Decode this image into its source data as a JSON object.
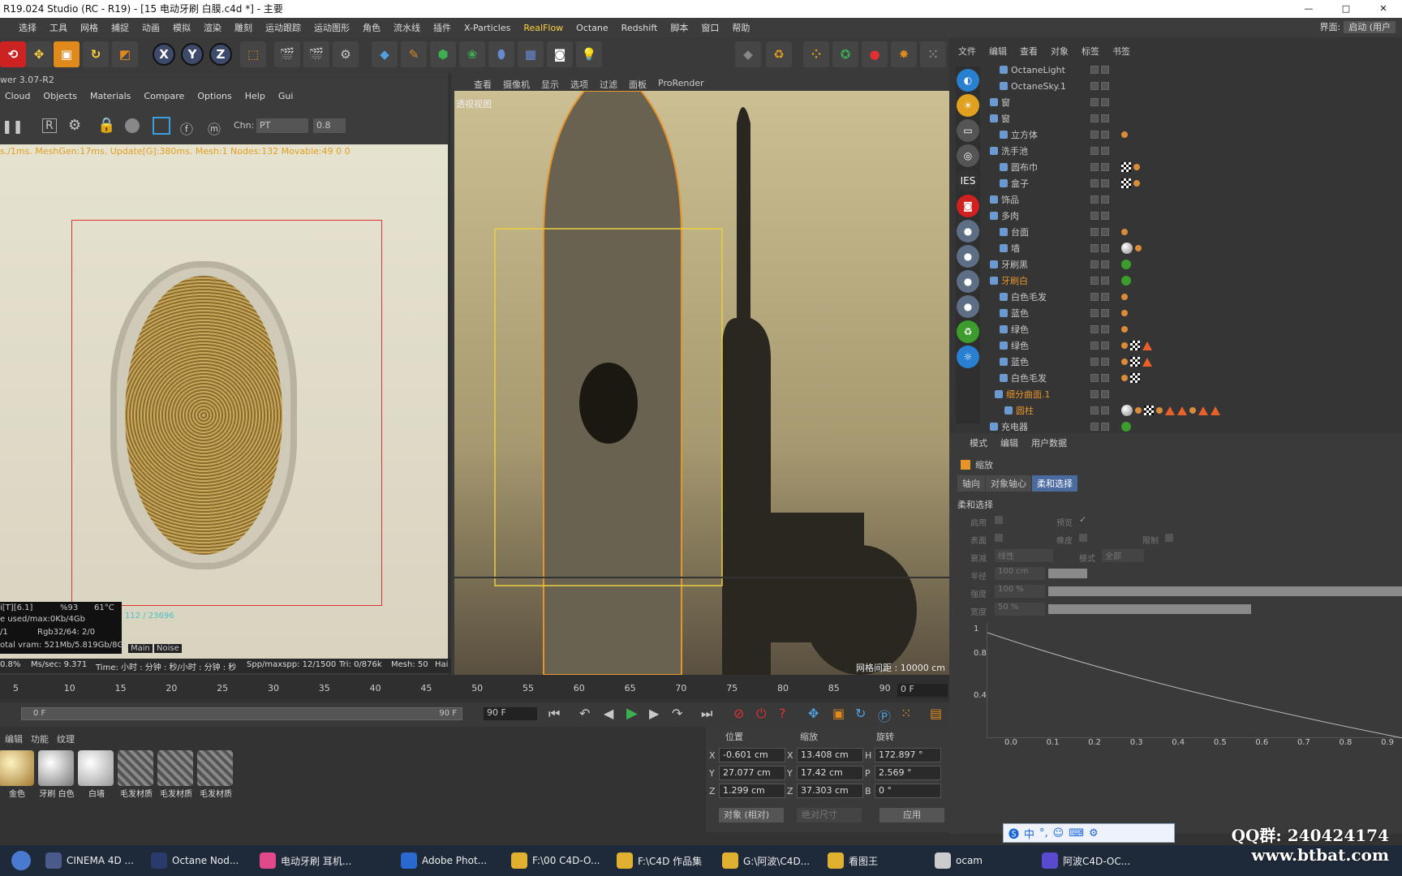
{
  "window": {
    "title": "R19.024 Studio (RC - R19) - [15 电动牙刷 白膜.c4d *] - 主要"
  },
  "menu": [
    "选择",
    "工具",
    "网格",
    "捕捉",
    "动画",
    "模拟",
    "渲染",
    "雕刻",
    "运动跟踪",
    "运动图形",
    "角色",
    "流水线",
    "插件",
    "X-Particles",
    "RealFlow",
    "Octane",
    "Redshift",
    "脚本",
    "窗口",
    "帮助"
  ],
  "layout": {
    "label": "界面:",
    "value": "启动 (用户"
  },
  "octane": {
    "version": "wer 3.07-R2",
    "menu": [
      "Cloud",
      "Objects",
      "Materials",
      "Compare",
      "Options",
      "Help",
      "Gui"
    ],
    "chn_label": "Chn:",
    "chn_value": "PT",
    "chn_num": "0.8",
    "status": "s./1ms. MeshGen:17ms. Update[G]:380ms. Mesh:1 Nodes:132 Movable:49  0 0",
    "stats": {
      "l1a": "i[T][6.1]",
      "l1b": "%93",
      "l1c": "61°C",
      "l2": "e used/max:0Kb/4Gb",
      "l2b": "112 / 23696",
      "l3a": "/1",
      "l3b": "Rgb32/64: 2/0",
      "l4": "otal vram: 521Mb/5.819Gb/8Gb",
      "main": "Main",
      "noise": "Noise"
    },
    "bottom": {
      "pct": "0.8%",
      "ms": "Ms/sec: 9.371",
      "time": "Time: 小时 : 分钟 : 秒/小时 : 分钟 : 秒",
      "spp": "Spp/maxspp: 12/1500",
      "tri": "Tri: 0/876k",
      "mesh": "Mesh: 50",
      "hai": "Hai"
    }
  },
  "viewport": {
    "menu": [
      "查看",
      "摄像机",
      "显示",
      "选项",
      "过滤",
      "面板",
      "ProRender"
    ],
    "label": "透视视图",
    "grid": "网格间距 : 10000 cm"
  },
  "objects": {
    "menu": [
      "文件",
      "编辑",
      "查看",
      "对象",
      "标签",
      "书签"
    ],
    "rows": [
      {
        "name": "OctaneLight"
      },
      {
        "name": "OctaneSky.1"
      },
      {
        "name": "窗"
      },
      {
        "name": "窗"
      },
      {
        "name": "立方体"
      },
      {
        "name": "洗手池"
      },
      {
        "name": "圆布巾"
      },
      {
        "name": "盒子"
      },
      {
        "name": "饰品"
      },
      {
        "name": "多肉"
      },
      {
        "name": "台面"
      },
      {
        "name": "墙"
      },
      {
        "name": "牙刷黑"
      },
      {
        "name": "牙刷白"
      },
      {
        "name": "白色毛发"
      },
      {
        "name": "蓝色"
      },
      {
        "name": "绿色"
      },
      {
        "name": "绿色"
      },
      {
        "name": "蓝色"
      },
      {
        "name": "白色毛发"
      },
      {
        "name": "细分曲面.1"
      },
      {
        "name": "圆柱"
      },
      {
        "name": "充电器"
      }
    ]
  },
  "attributes": {
    "menu": [
      "模式",
      "编辑",
      "用户数据"
    ],
    "title": "缩放",
    "tabs": [
      "轴向",
      "对象轴心",
      "柔和选择"
    ],
    "section": "柔和选择",
    "f": {
      "enable": "启用",
      "preview": "预览",
      "surface": "表面",
      "rubber": "橡皮",
      "limit": "限制",
      "falloff": "衰减",
      "falloff_v": "线性",
      "mode": "模式",
      "mode_v": "全部",
      "radius": "半径",
      "radius_v": "100 cm",
      "strength": "强度",
      "strength_v": "100 %",
      "width": "宽度",
      "width_v": "50 %"
    },
    "graph_y": [
      "1",
      "0.8",
      "0.4"
    ],
    "graph_x": [
      "0.0",
      "0.1",
      "0.2",
      "0.3",
      "0.4",
      "0.5",
      "0.6",
      "0.7",
      "0.8",
      "0.9"
    ]
  },
  "timeline": {
    "ticks": [
      "5",
      "10",
      "15",
      "20",
      "25",
      "30",
      "35",
      "40",
      "45",
      "50",
      "55",
      "60",
      "65",
      "70",
      "75",
      "80",
      "85",
      "90"
    ],
    "current": "0 F",
    "start": "0 F",
    "end": "90 F",
    "end2": "90 F"
  },
  "materials": {
    "menu": [
      "编辑",
      "功能",
      "纹理"
    ],
    "items": [
      "金色",
      "牙刷 白色",
      "白墙",
      "毛发材质",
      "毛发材质",
      "毛发材质"
    ]
  },
  "coords": {
    "headers": [
      "位置",
      "缩放",
      "旋转"
    ],
    "pos": {
      "x": "-0.601 cm",
      "y": "27.077 cm",
      "z": "1.299 cm"
    },
    "scale": {
      "x": "13.408 cm",
      "y": "17.42 cm",
      "z": "37.303 cm"
    },
    "rot": {
      "h": "172.897 °",
      "p": "2.569 °",
      "b": "0 °"
    },
    "mode": "对象 (相对)",
    "size": "绝对尺寸",
    "apply": "应用"
  },
  "taskbar": [
    "CINEMA 4D ...",
    "Octane Nod...",
    "电动牙刷 耳机...",
    "Adobe Phot...",
    "F:\\00 C4D-O...",
    "F:\\C4D 作品集",
    "G:\\阿波\\C4D...",
    "看图王",
    "ocam",
    "阿波C4D-OC..."
  ],
  "watermark": {
    "qq": "QQ群: 240424174",
    "site": "www.btbat.com"
  },
  "ime": [
    "中",
    "°,",
    "☺"
  ]
}
